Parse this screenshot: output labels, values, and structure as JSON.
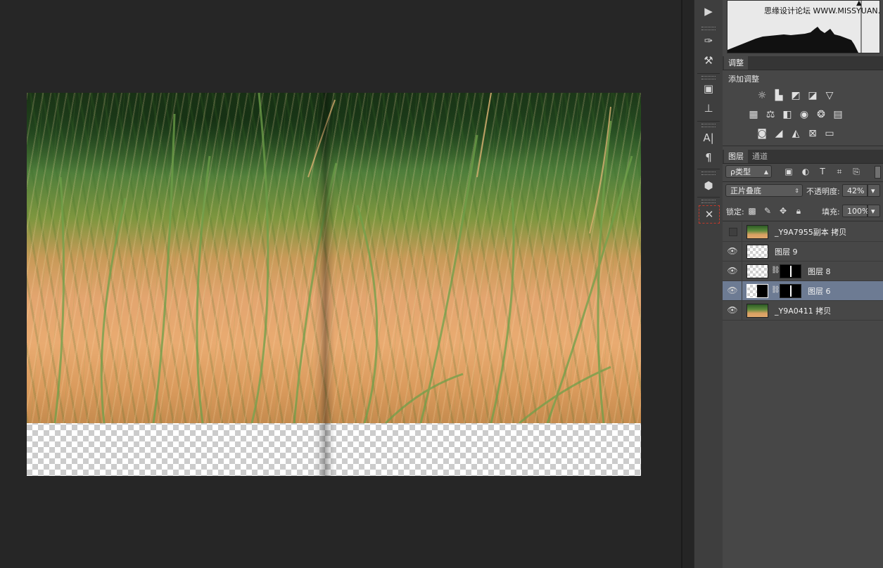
{
  "histogram": {
    "watermark": "思缘设计论坛 WWW.MISSYUAN.COM",
    "warning_icon": "warning-triangle-icon"
  },
  "adjustments_panel": {
    "tab_label": "调整",
    "add_label": "添加调整",
    "rows": [
      [
        "brightness-contrast-icon",
        "levels-icon",
        "curves-icon",
        "exposure-icon",
        "vibrance-icon"
      ],
      [
        "hue-saturation-icon",
        "color-balance-icon",
        "black-white-icon",
        "photo-filter-icon",
        "channel-mixer-icon",
        "color-lookup-icon"
      ],
      [
        "invert-icon",
        "posterize-icon",
        "threshold-icon",
        "selective-color-icon",
        "gradient-map-icon"
      ]
    ]
  },
  "layers_panel": {
    "tabs": [
      {
        "label": "图层",
        "active": true
      },
      {
        "label": "通道",
        "active": false
      }
    ],
    "filter_kind": "ρ类型",
    "blend_mode": "正片叠底",
    "opacity_label": "不透明度:",
    "opacity_value": "42%",
    "lock_label": "锁定:",
    "fill_label": "填充:",
    "fill_value": "100%",
    "layers": [
      {
        "name": "_Y9A7955副本 拷贝",
        "visible": false,
        "selected": false
      },
      {
        "name": "图层 9",
        "visible": true,
        "selected": false
      },
      {
        "name": "图层 8",
        "visible": true,
        "selected": false
      },
      {
        "name": "图层 6",
        "visible": true,
        "selected": true
      },
      {
        "name": "_Y9A0411 拷贝",
        "visible": true,
        "selected": false
      }
    ]
  },
  "tool_strip": {
    "tools": [
      "play-icon",
      "brush-presets-icon",
      "tool-presets-icon",
      "3d-icon",
      "clone-source-icon",
      "character-icon",
      "paragraph-icon",
      "3d-cube-icon",
      "close-icon"
    ]
  },
  "colors": {
    "panel_bg": "#474747",
    "selected_layer": "#6d7b93",
    "canvas_bg": "#262626"
  }
}
